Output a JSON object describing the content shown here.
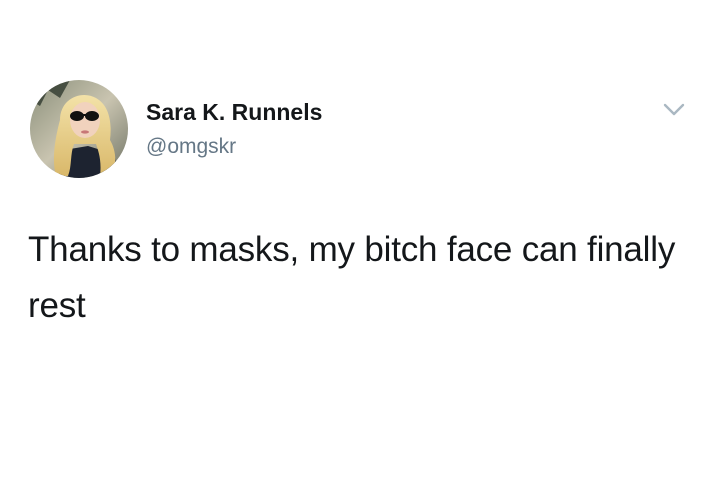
{
  "tweet": {
    "author": {
      "display_name": "Sara K. Runnels",
      "handle": "@omgskr"
    },
    "text": "Thanks to masks, my bitch face can finally rest"
  },
  "icons": {
    "menu": "chevron-down-icon"
  },
  "colors": {
    "name": "#14171a",
    "handle": "#657786",
    "caret": "#aab8c2"
  }
}
